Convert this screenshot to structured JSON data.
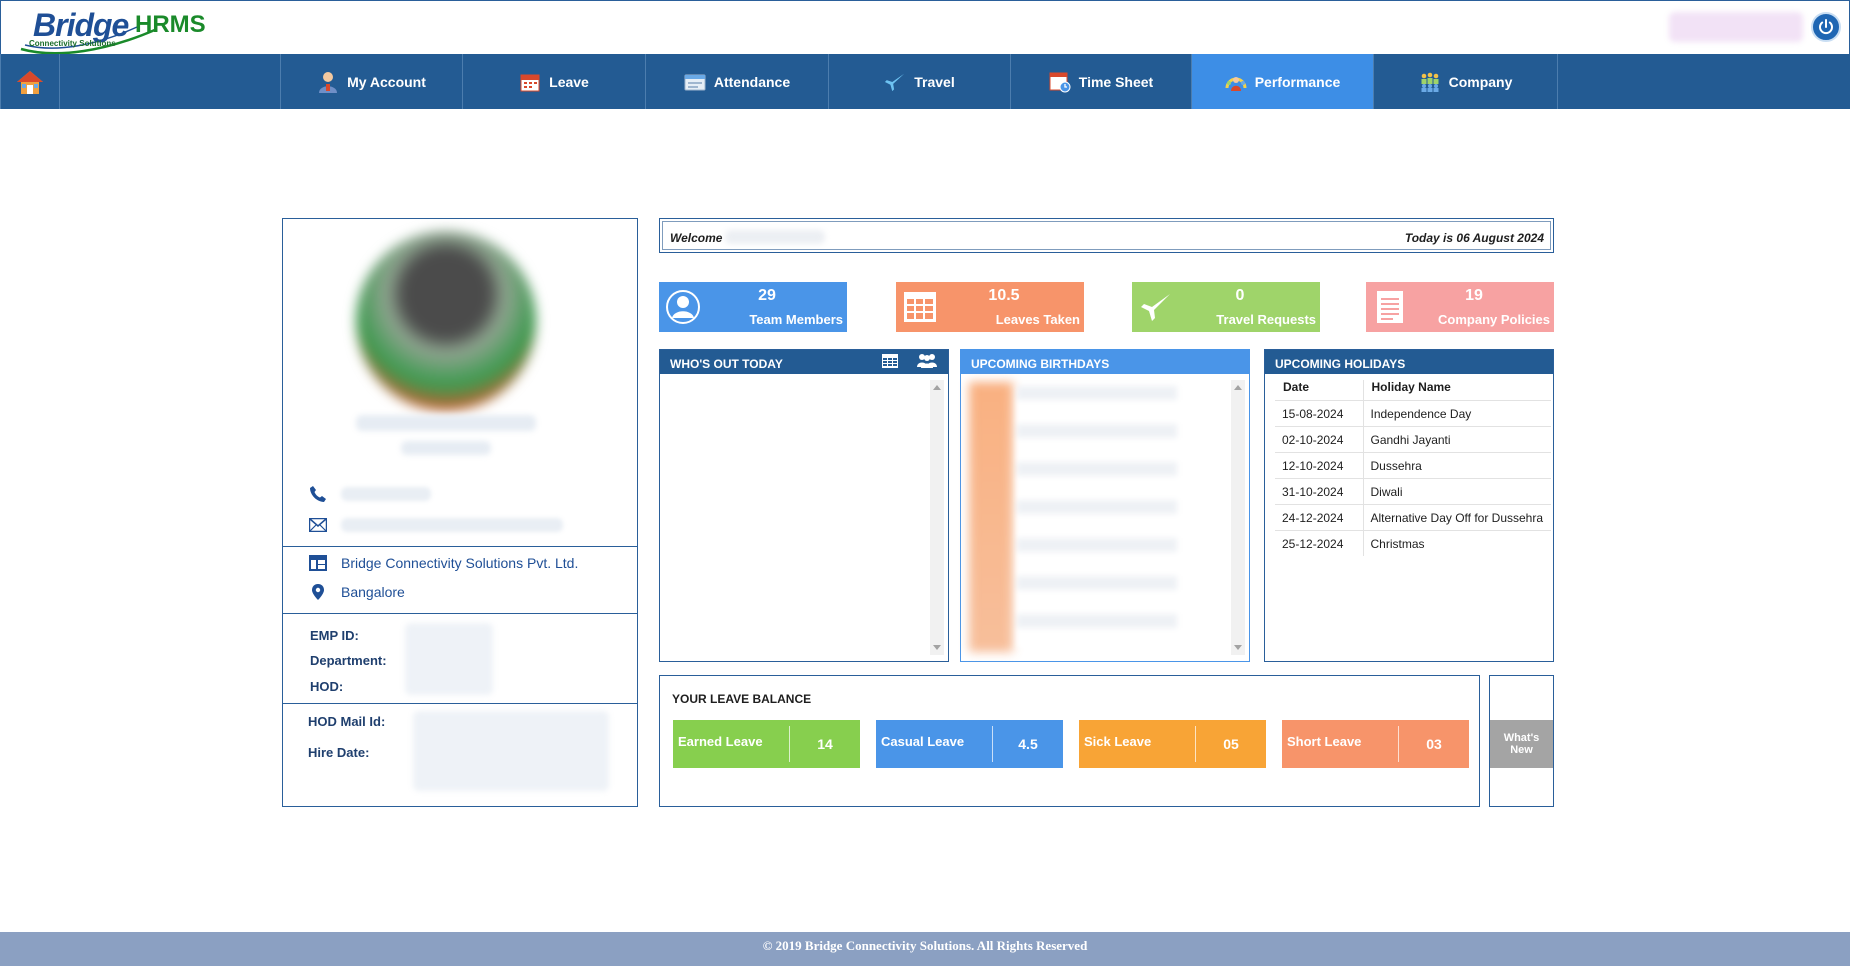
{
  "app": {
    "logo_main": "Bridge",
    "logo_product": "HRMS",
    "logo_tagline": "Connectivity Solutions"
  },
  "colors": {
    "nav_bg": "#235b93",
    "nav_active": "#3d8ee6",
    "brand_blue": "#1f4f96",
    "brand_green": "#1a8a2a"
  },
  "nav": {
    "items": [
      {
        "label": "My Account",
        "icon": "user-icon"
      },
      {
        "label": "Leave",
        "icon": "calendar-icon"
      },
      {
        "label": "Attendance",
        "icon": "attendance-card-icon"
      },
      {
        "label": "Travel",
        "icon": "airplane-icon"
      },
      {
        "label": "Time Sheet",
        "icon": "timesheet-icon"
      },
      {
        "label": "Performance",
        "icon": "performance-icon",
        "active": true
      },
      {
        "label": "Company",
        "icon": "company-icon"
      }
    ]
  },
  "profile": {
    "company": "Bridge Connectivity Solutions Pvt. Ltd.",
    "location": "Bangalore",
    "labels": {
      "emp_id": "EMP ID:",
      "department": "Department:",
      "hod": "HOD:",
      "hod_mail": "HOD Mail Id:",
      "hire_date": "Hire Date:"
    }
  },
  "welcome": {
    "label": "Welcome",
    "today": "Today is 06 August 2024"
  },
  "stats": [
    {
      "value": "29",
      "label": "Team Members",
      "color": "#4a95e8",
      "icon": "person-circle-icon"
    },
    {
      "value": "10.5",
      "label": "Leaves Taken",
      "color": "#f7946a",
      "icon": "table-grid-icon"
    },
    {
      "value": "0",
      "label": "Travel Requests",
      "color": "#9fd46a",
      "icon": "airplane-icon"
    },
    {
      "value": "19",
      "label": "Company Policies",
      "color": "#f7a2a2",
      "icon": "document-icon"
    }
  ],
  "panels": {
    "whos_out": {
      "title": "WHO'S OUT TODAY",
      "color": "#235b93"
    },
    "birthdays": {
      "title": "UPCOMING BIRTHDAYS",
      "color": "#4a95e8"
    },
    "holidays": {
      "title": "UPCOMING HOLIDAYS",
      "color": "#235b93",
      "columns": [
        "Date",
        "Holiday Name"
      ],
      "rows": [
        [
          "15-08-2024",
          "Independence Day"
        ],
        [
          "02-10-2024",
          "Gandhi Jayanti"
        ],
        [
          "12-10-2024",
          "Dussehra"
        ],
        [
          "31-10-2024",
          "Diwali"
        ],
        [
          "24-12-2024",
          "Alternative Day Off for Dussehra"
        ],
        [
          "25-12-2024",
          "Christmas"
        ]
      ]
    }
  },
  "leave_balance": {
    "title": "YOUR LEAVE BALANCE",
    "items": [
      {
        "name": "Earned Leave",
        "value": "14",
        "color": "#87cf4e"
      },
      {
        "name": "Casual Leave",
        "value": "4.5",
        "color": "#4a95e8"
      },
      {
        "name": "Sick Leave",
        "value": "05",
        "color": "#f8a436"
      },
      {
        "name": "Short Leave",
        "value": "03",
        "color": "#f7946a"
      }
    ],
    "whats_new_line1": "What's",
    "whats_new_line2": "New"
  },
  "footer": {
    "text": "© 2019 Bridge Connectivity Solutions. All Rights Reserved"
  }
}
